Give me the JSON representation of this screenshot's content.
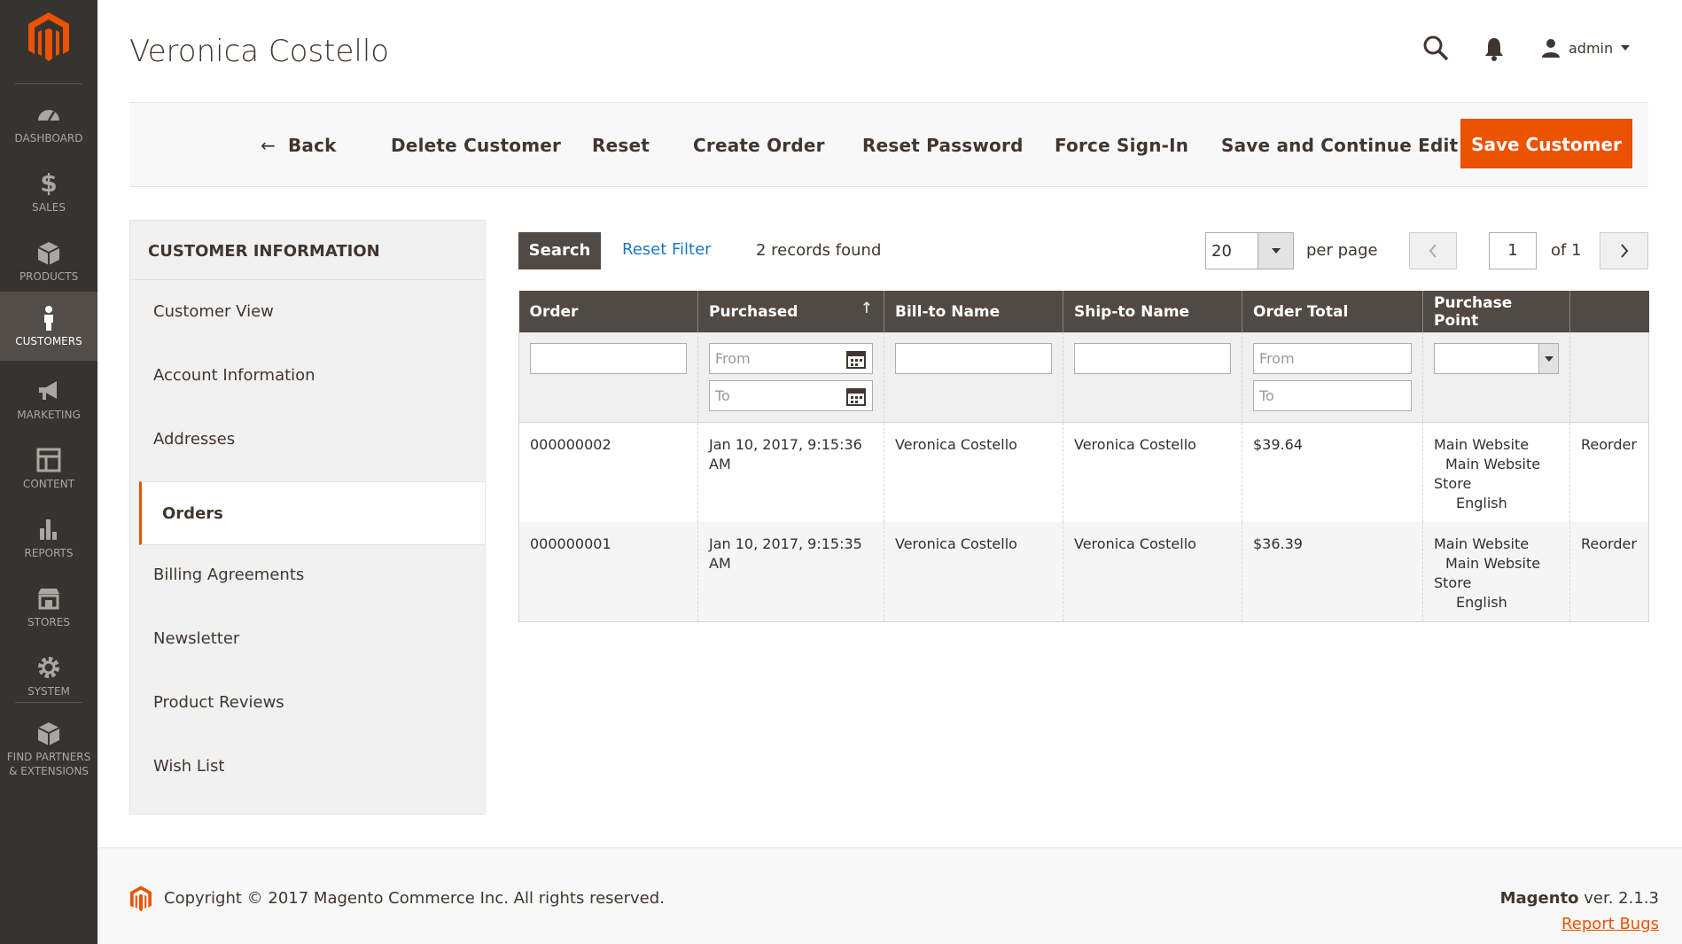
{
  "sidebar": {
    "items": [
      {
        "label": "DASHBOARD",
        "icon": "dashboard-icon"
      },
      {
        "label": "SALES",
        "icon": "dollar-icon"
      },
      {
        "label": "PRODUCTS",
        "icon": "box-icon"
      },
      {
        "label": "CUSTOMERS",
        "icon": "person-icon",
        "active": true
      },
      {
        "label": "MARKETING",
        "icon": "megaphone-icon"
      },
      {
        "label": "CONTENT",
        "icon": "layout-icon"
      },
      {
        "label": "REPORTS",
        "icon": "bar-chart-icon"
      },
      {
        "label": "STORES",
        "icon": "store-icon"
      },
      {
        "label": "SYSTEM",
        "icon": "gear-icon"
      },
      {
        "label": "FIND PARTNERS & EXTENSIONS",
        "icon": "cube-icon"
      }
    ]
  },
  "header": {
    "title": "Veronica Costello",
    "user": "admin"
  },
  "actions": {
    "back": "Back",
    "delete": "Delete Customer",
    "reset": "Reset",
    "create_order": "Create Order",
    "reset_password": "Reset Password",
    "force_signin": "Force Sign-In",
    "save_continue": "Save and Continue Edit",
    "save": "Save Customer"
  },
  "tabs": {
    "title": "CUSTOMER INFORMATION",
    "items": [
      "Customer View",
      "Account Information",
      "Addresses",
      "Orders",
      "Billing Agreements",
      "Newsletter",
      "Product Reviews",
      "Wish List"
    ],
    "active": "Orders"
  },
  "grid_toolbar": {
    "search": "Search",
    "reset_filter": "Reset Filter",
    "records": "2 records found",
    "per_page_value": "20",
    "per_page_label": "per page",
    "page": "1",
    "of": "of 1"
  },
  "grid": {
    "columns": [
      "Order",
      "Purchased",
      "Bill-to Name",
      "Ship-to Name",
      "Order Total",
      "Purchase Point",
      ""
    ],
    "filters": {
      "from": "From",
      "to": "To"
    },
    "rows": [
      {
        "order": "000000002",
        "purchased": "Jan 10, 2017, 9:15:36 AM",
        "bill_to": "Veronica Costello",
        "ship_to": "Veronica Costello",
        "total": "$39.64",
        "pp1": "Main Website",
        "pp2": "Main Website",
        "pp3": "Store",
        "pp4": "English",
        "action": "Reorder"
      },
      {
        "order": "000000001",
        "purchased": "Jan 10, 2017, 9:15:35 AM",
        "bill_to": "Veronica Costello",
        "ship_to": "Veronica Costello",
        "total": "$36.39",
        "pp1": "Main Website",
        "pp2": "Main Website",
        "pp3": "Store",
        "pp4": "English",
        "action": "Reorder"
      }
    ]
  },
  "footer": {
    "copyright": "Copyright © 2017 Magento Commerce Inc. All rights reserved.",
    "brand": "Magento",
    "version": " ver. 2.1.3",
    "report_bugs": "Report Bugs"
  },
  "colors": {
    "accent": "#eb5202",
    "sidebar_bg": "#373330",
    "header_bg": "#514943",
    "link": "#1979c3"
  }
}
